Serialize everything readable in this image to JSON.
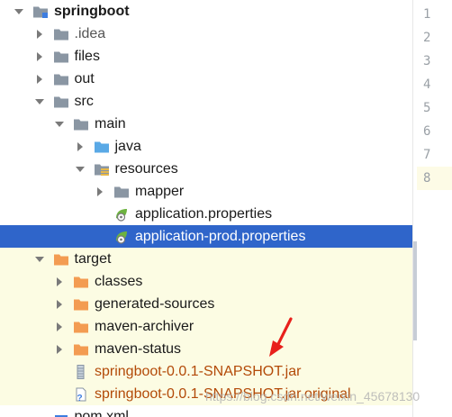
{
  "tree": {
    "items": [
      {
        "label": "springboot",
        "depth": 0,
        "arrow": "down",
        "icon": "module-folder-icon",
        "style": "bold"
      },
      {
        "label": ".idea",
        "depth": 1,
        "arrow": "right",
        "icon": "folder-icon",
        "style": "gray"
      },
      {
        "label": "files",
        "depth": 1,
        "arrow": "right",
        "icon": "folder-icon"
      },
      {
        "label": "out",
        "depth": 1,
        "arrow": "right",
        "icon": "folder-icon"
      },
      {
        "label": "src",
        "depth": 1,
        "arrow": "down",
        "icon": "folder-icon"
      },
      {
        "label": "main",
        "depth": 2,
        "arrow": "down",
        "icon": "folder-icon"
      },
      {
        "label": "java",
        "depth": 3,
        "arrow": "right",
        "icon": "source-folder-icon"
      },
      {
        "label": "resources",
        "depth": 3,
        "arrow": "down",
        "icon": "resources-folder-icon"
      },
      {
        "label": "mapper",
        "depth": 4,
        "arrow": "right",
        "icon": "folder-icon"
      },
      {
        "label": "application.properties",
        "depth": 4,
        "arrow": "none",
        "icon": "spring-properties-icon"
      },
      {
        "label": "application-prod.properties",
        "depth": 4,
        "arrow": "none",
        "icon": "spring-properties-icon",
        "selected": true
      },
      {
        "label": "target",
        "depth": 1,
        "arrow": "down",
        "icon": "excluded-folder-icon",
        "excluded": true
      },
      {
        "label": "classes",
        "depth": 2,
        "arrow": "right",
        "icon": "excluded-folder-icon",
        "excluded": true
      },
      {
        "label": "generated-sources",
        "depth": 2,
        "arrow": "right",
        "icon": "excluded-folder-icon",
        "excluded": true
      },
      {
        "label": "maven-archiver",
        "depth": 2,
        "arrow": "right",
        "icon": "excluded-folder-icon",
        "excluded": true
      },
      {
        "label": "maven-status",
        "depth": 2,
        "arrow": "right",
        "icon": "excluded-folder-icon",
        "excluded": true
      },
      {
        "label": "springboot-0.0.1-SNAPSHOT.jar",
        "depth": 2,
        "arrow": "none",
        "icon": "jar-icon",
        "excluded": true,
        "style": "jar"
      },
      {
        "label": "springboot-0.0.1-SNAPSHOT.jar.original",
        "depth": 2,
        "arrow": "none",
        "icon": "unknown-file-icon",
        "excluded": true,
        "style": "jar"
      },
      {
        "label": "pom.xml",
        "depth": 1,
        "arrow": "none",
        "icon": "maven-icon"
      }
    ]
  },
  "editor": {
    "line_numbers": [
      "1",
      "2",
      "3",
      "4",
      "5",
      "6",
      "7",
      "8"
    ],
    "current_line": "8"
  },
  "watermark": {
    "text": "https://blog.csdn.net/weixin_45678130"
  },
  "colors": {
    "selection": "#2f65ca",
    "excluded_bg": "#fcfce3",
    "folder": "#8a96a3",
    "excluded_folder": "#f39c52",
    "source_folder": "#5aa9e6",
    "jar_text": "#b34a08",
    "annotation_arrow": "#e8201b"
  }
}
